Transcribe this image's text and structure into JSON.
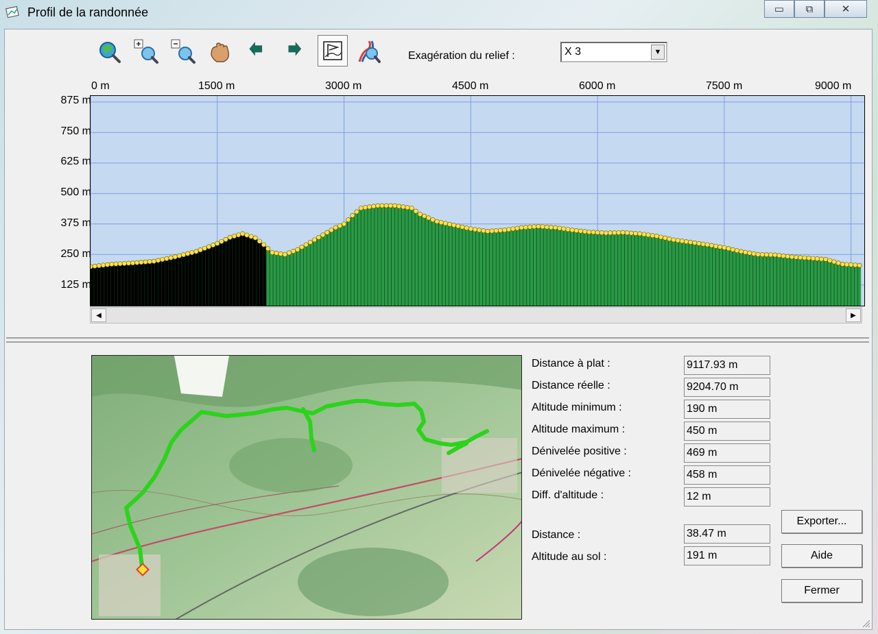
{
  "window": {
    "title": "Profil de la randonnée",
    "minimize_glyph": "▭",
    "maximize_glyph": "⧉",
    "close_glyph": "✕"
  },
  "toolbar": {
    "tools": [
      {
        "name": "zoom-extent-icon"
      },
      {
        "name": "zoom-in-icon"
      },
      {
        "name": "zoom-out-icon"
      },
      {
        "name": "pan-hand-icon"
      },
      {
        "name": "arrow-left-icon"
      },
      {
        "name": "arrow-right-icon"
      },
      {
        "name": "profile-flag-icon",
        "active": true
      },
      {
        "name": "route-zoom-icon"
      }
    ],
    "exaggeration_label": "Exagération du relief :",
    "exaggeration_value": "X 3"
  },
  "chart_data": {
    "type": "area",
    "x_ticks": [
      "0 m",
      "1500 m",
      "3000 m",
      "4500 m",
      "6000 m",
      "7500 m",
      "9000 m"
    ],
    "y_ticks": [
      "875 m",
      "750 m",
      "625 m",
      "500 m",
      "375 m",
      "250 m",
      "125 m"
    ],
    "xlim": [
      0,
      9118
    ],
    "ylim": [
      40,
      900
    ],
    "x": [
      0,
      250,
      500,
      750,
      1000,
      1250,
      1500,
      1650,
      1800,
      1950,
      2050,
      2150,
      2300,
      2450,
      2600,
      2750,
      2900,
      3000,
      3100,
      3200,
      3400,
      3600,
      3800,
      3900,
      4100,
      4300,
      4500,
      4700,
      4900,
      5100,
      5300,
      5500,
      5700,
      5900,
      6100,
      6300,
      6500,
      6700,
      6900,
      7100,
      7300,
      7500,
      7700,
      7900,
      8100,
      8300,
      8500,
      8700,
      8900,
      9118
    ],
    "y": [
      200,
      210,
      215,
      222,
      240,
      262,
      295,
      320,
      335,
      318,
      290,
      258,
      250,
      270,
      300,
      330,
      360,
      375,
      410,
      440,
      450,
      450,
      440,
      415,
      385,
      370,
      355,
      345,
      350,
      360,
      365,
      360,
      350,
      342,
      338,
      340,
      335,
      325,
      310,
      300,
      290,
      278,
      262,
      250,
      248,
      240,
      235,
      230,
      210,
      205
    ],
    "highlight_until_x": 2080,
    "colors": {
      "sky": "#c5d9f1",
      "grid": "#7f9fe0",
      "fill": "#2a9a45",
      "covered": "#000000",
      "dots": "#ffe14d"
    }
  },
  "map": {
    "route_color": "#2cd31c",
    "start_marker_color": "#e53a2a"
  },
  "stats": [
    {
      "label": "Distance à plat :",
      "value": "9117.93 m"
    },
    {
      "label": "Distance réelle :",
      "value": "9204.70 m"
    },
    {
      "label": "Altitude minimum :",
      "value": "190 m"
    },
    {
      "label": "Altitude maximum :",
      "value": "450 m"
    },
    {
      "label": "Dénivelée positive :",
      "value": "469 m"
    },
    {
      "label": "Dénivelée négative :",
      "value": "458 m"
    },
    {
      "label": "Diff. d'altitude :",
      "value": "12 m"
    }
  ],
  "cursor": {
    "distance_label": "Distance :",
    "distance_value": "38.47 m",
    "altitude_label": "Altitude au sol :",
    "altitude_value": "191 m"
  },
  "buttons": {
    "export": "Exporter...",
    "help": "Aide",
    "close": "Fermer"
  }
}
